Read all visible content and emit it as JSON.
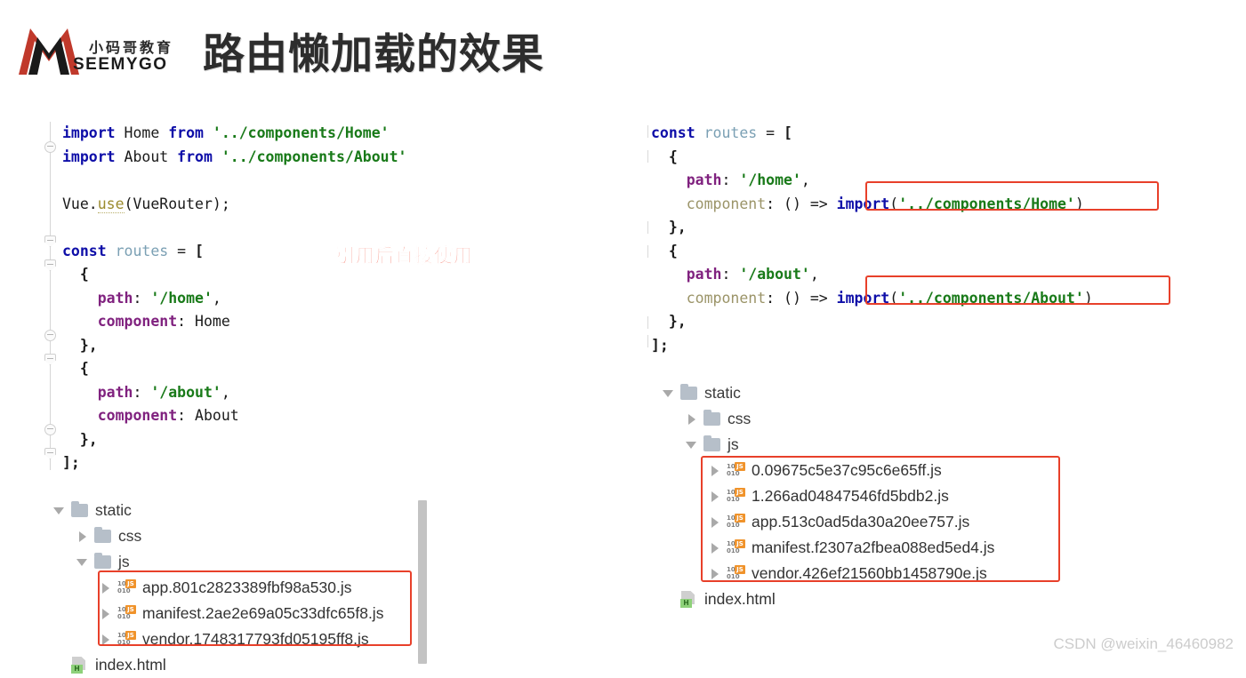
{
  "header": {
    "logo_cn": "小码哥教育",
    "logo_en": "SEEMYGO",
    "title": "路由懒加载的效果"
  },
  "annotation": {
    "text": "引用后直接使用",
    "color": "#f03018"
  },
  "left_code": {
    "lines": [
      [
        {
          "t": "import",
          "c": "kw"
        },
        {
          "t": " Home ",
          "c": "id"
        },
        {
          "t": "from",
          "c": "kw"
        },
        {
          "t": " ",
          "c": "id"
        },
        {
          "t": "'../components/Home'",
          "c": "str"
        }
      ],
      [
        {
          "t": "import",
          "c": "kw"
        },
        {
          "t": " About ",
          "c": "id"
        },
        {
          "t": "from",
          "c": "kw"
        },
        {
          "t": " ",
          "c": "id"
        },
        {
          "t": "'../components/About'",
          "c": "str"
        }
      ],
      [],
      [
        {
          "t": "Vue.",
          "c": "id"
        },
        {
          "t": "use",
          "c": "fn"
        },
        {
          "t": "(VueRouter);",
          "c": "id"
        }
      ],
      [],
      [
        {
          "t": "const",
          "c": "kw"
        },
        {
          "t": " ",
          "c": "id"
        },
        {
          "t": "routes",
          "c": "var"
        },
        {
          "t": " = ",
          "c": "op"
        },
        {
          "t": "[",
          "c": "br"
        }
      ],
      [
        {
          "t": "  {",
          "c": "br"
        }
      ],
      [
        {
          "t": "    ",
          "c": "id"
        },
        {
          "t": "path",
          "c": "prop"
        },
        {
          "t": ": ",
          "c": "punc"
        },
        {
          "t": "'/home'",
          "c": "str"
        },
        {
          "t": ",",
          "c": "punc"
        }
      ],
      [
        {
          "t": "    ",
          "c": "id"
        },
        {
          "t": "component",
          "c": "prop"
        },
        {
          "t": ": ",
          "c": "punc"
        },
        {
          "t": "Home",
          "c": "id"
        }
      ],
      [
        {
          "t": "  },",
          "c": "br"
        }
      ],
      [
        {
          "t": "  {",
          "c": "br"
        }
      ],
      [
        {
          "t": "    ",
          "c": "id"
        },
        {
          "t": "path",
          "c": "prop"
        },
        {
          "t": ": ",
          "c": "punc"
        },
        {
          "t": "'/about'",
          "c": "str"
        },
        {
          "t": ",",
          "c": "punc"
        }
      ],
      [
        {
          "t": "    ",
          "c": "id"
        },
        {
          "t": "component",
          "c": "prop"
        },
        {
          "t": ": ",
          "c": "punc"
        },
        {
          "t": "About",
          "c": "id"
        }
      ],
      [
        {
          "t": "  },",
          "c": "br"
        }
      ],
      [
        {
          "t": "];",
          "c": "br"
        }
      ]
    ]
  },
  "right_code": {
    "lines": [
      [
        {
          "t": "const",
          "c": "kw"
        },
        {
          "t": " ",
          "c": "id"
        },
        {
          "t": "routes",
          "c": "var"
        },
        {
          "t": " = ",
          "c": "op"
        },
        {
          "t": "[",
          "c": "br"
        }
      ],
      [
        {
          "t": "  {",
          "c": "br"
        }
      ],
      [
        {
          "t": "    ",
          "c": "id"
        },
        {
          "t": "path",
          "c": "prop"
        },
        {
          "t": ": ",
          "c": "punc"
        },
        {
          "t": "'/home'",
          "c": "str"
        },
        {
          "t": ",",
          "c": "punc"
        }
      ],
      [
        {
          "t": "    ",
          "c": "id"
        },
        {
          "t": "component",
          "c": "propdim"
        },
        {
          "t": ": ",
          "c": "punc"
        },
        {
          "t": "() => ",
          "c": "id"
        },
        {
          "t": "import",
          "c": "kw"
        },
        {
          "t": "(",
          "c": "punc"
        },
        {
          "t": "'../components/Home'",
          "c": "str"
        },
        {
          "t": ")",
          "c": "punc"
        }
      ],
      [
        {
          "t": "  },",
          "c": "br"
        }
      ],
      [
        {
          "t": "  {",
          "c": "br"
        }
      ],
      [
        {
          "t": "    ",
          "c": "id"
        },
        {
          "t": "path",
          "c": "prop"
        },
        {
          "t": ": ",
          "c": "punc"
        },
        {
          "t": "'/about'",
          "c": "str"
        },
        {
          "t": ",",
          "c": "punc"
        }
      ],
      [
        {
          "t": "    ",
          "c": "id"
        },
        {
          "t": "component",
          "c": "propdim"
        },
        {
          "t": ": ",
          "c": "punc"
        },
        {
          "t": "() => ",
          "c": "id"
        },
        {
          "t": "import",
          "c": "kw"
        },
        {
          "t": "(",
          "c": "punc"
        },
        {
          "t": "'../components/About'",
          "c": "str"
        },
        {
          "t": ")",
          "c": "punc"
        }
      ],
      [
        {
          "t": "  },",
          "c": "br"
        }
      ],
      [
        {
          "t": "];",
          "c": "br"
        }
      ]
    ]
  },
  "left_tree": {
    "rows": [
      {
        "label": "static",
        "icon": "folder",
        "tri": "down",
        "indent": 0,
        "boxed": false
      },
      {
        "label": "css",
        "icon": "folder",
        "tri": "right",
        "indent": 1,
        "boxed": false
      },
      {
        "label": "js",
        "icon": "folder",
        "tri": "down",
        "indent": 1,
        "boxed": false
      },
      {
        "label": "app.801c2823389fbf98a530.js",
        "icon": "js",
        "tri": "right",
        "indent": 2,
        "boxed": true
      },
      {
        "label": "manifest.2ae2e69a05c33dfc65f8.js",
        "icon": "js",
        "tri": "right",
        "indent": 2,
        "boxed": true
      },
      {
        "label": "vendor.1748317793fd05195ff8.js",
        "icon": "js",
        "tri": "right",
        "indent": 2,
        "boxed": true
      },
      {
        "label": "index.html",
        "icon": "html",
        "tri": "none",
        "indent": 0,
        "boxed": false
      }
    ]
  },
  "right_tree": {
    "rows": [
      {
        "label": "static",
        "icon": "folder",
        "tri": "down",
        "indent": 0,
        "boxed": false
      },
      {
        "label": "css",
        "icon": "folder",
        "tri": "right",
        "indent": 1,
        "boxed": false
      },
      {
        "label": "js",
        "icon": "folder",
        "tri": "down",
        "indent": 1,
        "boxed": false
      },
      {
        "label": "0.09675c5e37c95c6e65ff.js",
        "icon": "js",
        "tri": "right",
        "indent": 2,
        "boxed": true
      },
      {
        "label": "1.266ad04847546fd5bdb2.js",
        "icon": "js",
        "tri": "right",
        "indent": 2,
        "boxed": true
      },
      {
        "label": "app.513c0ad5da30a20ee757.js",
        "icon": "js",
        "tri": "right",
        "indent": 2,
        "boxed": true
      },
      {
        "label": "manifest.f2307a2fbea088ed5ed4.js",
        "icon": "js",
        "tri": "right",
        "indent": 2,
        "boxed": true
      },
      {
        "label": "vendor.426ef21560bb1458790e.js",
        "icon": "js",
        "tri": "right",
        "indent": 2,
        "boxed": true
      },
      {
        "label": "index.html",
        "icon": "html",
        "tri": "none",
        "indent": 0,
        "boxed": false
      }
    ]
  },
  "icons": {
    "js_bits_top": "10",
    "js_bits_bottom": "010",
    "js_badge": "JS",
    "html_badge": "H"
  },
  "watermark": "CSDN @weixin_46460982",
  "colors": {
    "accent_red": "#e8402a",
    "keyword": "#0e0ea8",
    "string": "#197a19",
    "property": "#80227f",
    "folder": "#b6bfc9",
    "js_badge": "#f0932b"
  }
}
